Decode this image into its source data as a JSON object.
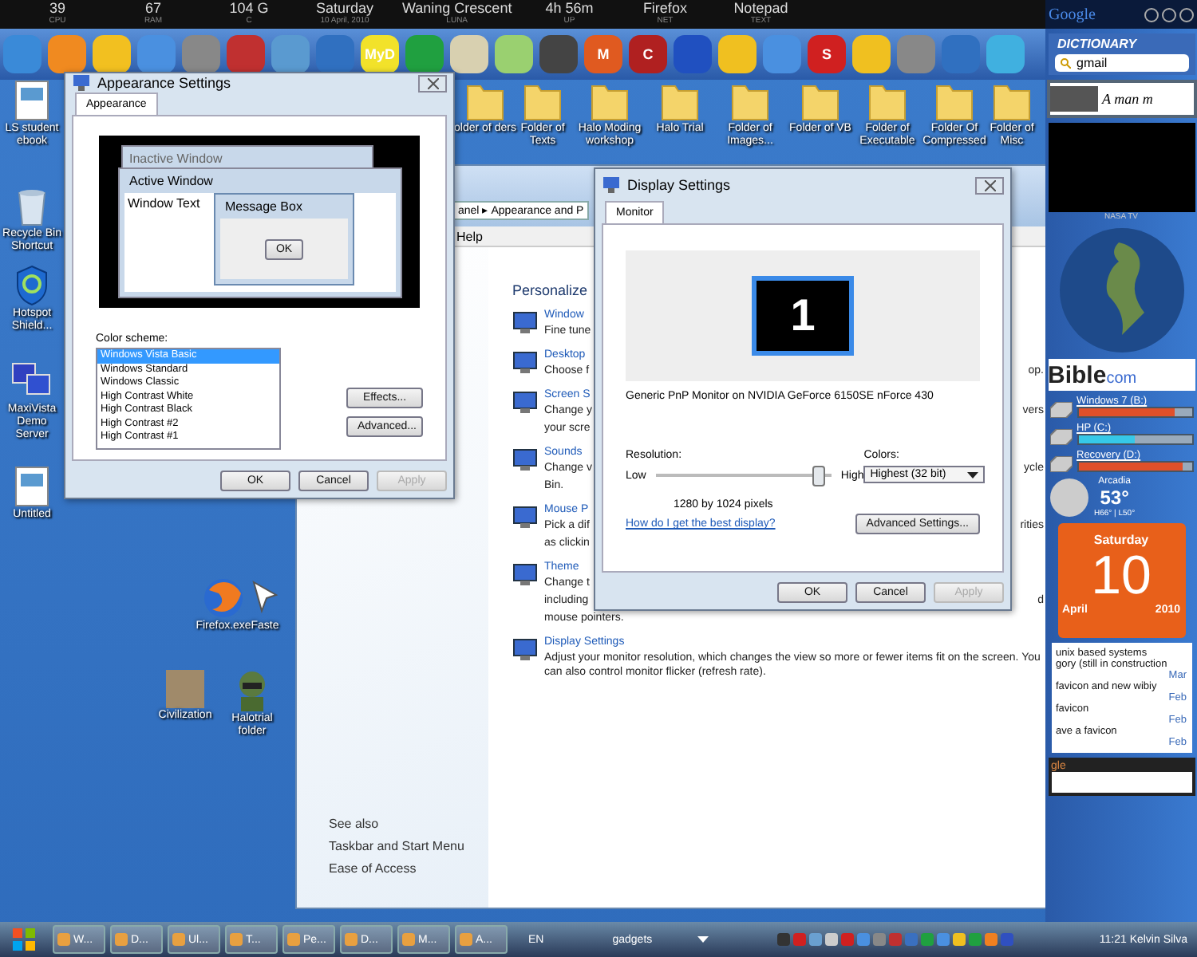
{
  "top_bar": {
    "stats": [
      {
        "value": "39",
        "label": "CPU"
      },
      {
        "value": "67",
        "label": "RAM"
      },
      {
        "value": "104 G",
        "label": "C"
      },
      {
        "value": "Saturday",
        "label": "10 April, 2010"
      },
      {
        "value": "Waning Crescent",
        "label": "LUNA"
      },
      {
        "value": "4h 56m",
        "label": "UP"
      },
      {
        "value": "Firefox",
        "label": "NET"
      },
      {
        "value": "Notepad",
        "label": "TEXT"
      }
    ]
  },
  "dock": {
    "labels": [
      "MyD",
      "M",
      "C",
      "S"
    ]
  },
  "desktop_icons": [
    {
      "label": "LS student ebook",
      "kind": "file"
    },
    {
      "label": "Recycle Bin Shortcut",
      "kind": "bin"
    },
    {
      "label": "Hotspot Shield...",
      "kind": "shield"
    },
    {
      "label": "MaxiVista Demo Server",
      "kind": "monitors"
    },
    {
      "label": "Untitled",
      "kind": "file"
    },
    {
      "label": "Firefox.exe",
      "kind": "globe"
    },
    {
      "label": "Faste",
      "kind": "cursor"
    },
    {
      "label": "Civilization",
      "kind": "photo"
    },
    {
      "label": "Halotrial folder",
      "kind": "figure"
    },
    {
      "label": "older of ders",
      "kind": "folder"
    },
    {
      "label": "Folder of Texts",
      "kind": "folder"
    },
    {
      "label": "Halo Moding workshop",
      "kind": "folder"
    },
    {
      "label": "Halo Trial",
      "kind": "folder"
    },
    {
      "label": "Folder of Images...",
      "kind": "folder"
    },
    {
      "label": "Folder of VB",
      "kind": "folder"
    },
    {
      "label": "Folder of Executable",
      "kind": "folder"
    },
    {
      "label": "Folder Of Compressed",
      "kind": "folder"
    },
    {
      "label": "Folder of Misc",
      "kind": "folder"
    }
  ],
  "control_panel": {
    "address": "anel ▸ Appearance and P",
    "menu": "Help",
    "heading": "Personalize",
    "items": [
      {
        "title": "Window",
        "lines": [
          {
            "text": "Fine tune"
          }
        ]
      },
      {
        "title": "Desktop",
        "lines": [
          {
            "text": "Choose f",
            "tail": "op."
          }
        ]
      },
      {
        "title": "Screen S",
        "lines": [
          {
            "text": "Change y",
            "tail": "vers"
          },
          {
            "text": "your scre"
          }
        ]
      },
      {
        "title": "Sounds",
        "lines": [
          {
            "text": "Change v",
            "tail": "ycle"
          },
          {
            "text": "Bin."
          }
        ]
      },
      {
        "title": "Mouse P",
        "lines": [
          {
            "text": "Pick a dif",
            "tail": "rities"
          },
          {
            "text": "as clickin"
          }
        ]
      },
      {
        "title": "Theme",
        "lines": [
          {
            "text": "Change t"
          },
          {
            "text": "including",
            "tail": "d"
          },
          {
            "text": "mouse pointers."
          }
        ]
      },
      {
        "title": "Display Settings",
        "lines": [
          {
            "text": "Adjust your monitor resolution, which changes the view so more or fewer items fit on the screen. You can also control monitor flicker (refresh rate)."
          }
        ]
      }
    ],
    "see_also": {
      "title": "See also",
      "links": [
        "Taskbar and Start Menu",
        "Ease of Access"
      ]
    }
  },
  "appearance_window": {
    "title": "Appearance Settings",
    "tabs": [
      {
        "label": "Appearance",
        "selected": true
      }
    ],
    "preview": {
      "inactive": "Inactive Window",
      "active": "Active Window",
      "text": "Window Text",
      "message": "Message Box",
      "ok": "OK"
    },
    "scheme_label": "Color scheme:",
    "schemes": [
      {
        "label": "Windows Vista Basic",
        "selected": true
      },
      {
        "label": "Windows Standard",
        "selected": false
      },
      {
        "label": "Windows Classic",
        "selected": false
      },
      {
        "label": "High Contrast White",
        "selected": false
      },
      {
        "label": "High Contrast Black",
        "selected": false
      },
      {
        "label": "High Contrast #2",
        "selected": false
      },
      {
        "label": "High Contrast #1",
        "selected": false
      }
    ],
    "side_buttons": [
      "Effects...",
      "Advanced..."
    ],
    "buttons": [
      {
        "label": "OK",
        "disabled": false
      },
      {
        "label": "Cancel",
        "disabled": false
      },
      {
        "label": "Apply",
        "disabled": true
      }
    ]
  },
  "display_window": {
    "title": "Display Settings",
    "tabs": [
      {
        "label": "Monitor",
        "selected": true
      }
    ],
    "monitor_number": "1",
    "monitor_name": "Generic PnP Monitor on NVIDIA GeForce 6150SE nForce 430",
    "resolution_label": "Resolution:",
    "low": "Low",
    "high": "High",
    "level": 0.92,
    "pixels": "1280 by 1024 pixels",
    "colors_label": "Colors:",
    "colors_value": "Highest (32 bit)",
    "help_link": "How do I get the best display?",
    "advanced": "Advanced Settings...",
    "buttons": [
      {
        "label": "OK",
        "disabled": false
      },
      {
        "label": "Cancel",
        "disabled": false
      },
      {
        "label": "Apply",
        "disabled": true
      }
    ]
  },
  "gadgets": {
    "google": "Google",
    "dictionary": "DICTIONARY",
    "dictionary_value": "gmail",
    "quote": "A man m",
    "tv_label": "NASA TV",
    "bible": "Bible",
    "bible_suffix": "com",
    "drives": [
      {
        "label": "Windows 7 (B:)",
        "level": 0.85,
        "color": "#e0502a"
      },
      {
        "label": "HP (C:)",
        "level": 0.5,
        "color": "#36c8e8"
      },
      {
        "label": "Recovery (D:)",
        "level": 0.92,
        "color": "#e0502a"
      }
    ],
    "weather": {
      "city": "Arcadia",
      "temp": "53°",
      "range": "H66° | L50°"
    },
    "calendar": {
      "weekday": "Saturday",
      "day": "10",
      "month": "April",
      "year": "2010"
    },
    "feed": [
      {
        "text": "unix based systems",
        "kind": "line"
      },
      {
        "text": "gory (still in construction",
        "kind": "line"
      },
      {
        "text": "Mar",
        "kind": "date"
      },
      {
        "text": "favicon and new wibiy",
        "kind": "line"
      },
      {
        "text": "Feb",
        "kind": "date"
      },
      {
        "text": "favicon",
        "kind": "line"
      },
      {
        "text": "Feb",
        "kind": "date"
      },
      {
        "text": "ave a favicon",
        "kind": "line"
      },
      {
        "text": "Feb",
        "kind": "date"
      }
    ],
    "search_logo": "gle"
  },
  "taskbar": {
    "tasks": [
      "W...",
      "D...",
      "Ul...",
      "T...",
      "Pe...",
      "D...",
      "M...",
      "A..."
    ],
    "language": "EN",
    "toolbar": "gadgets",
    "clock": "11:21 Kelvin Silva"
  }
}
